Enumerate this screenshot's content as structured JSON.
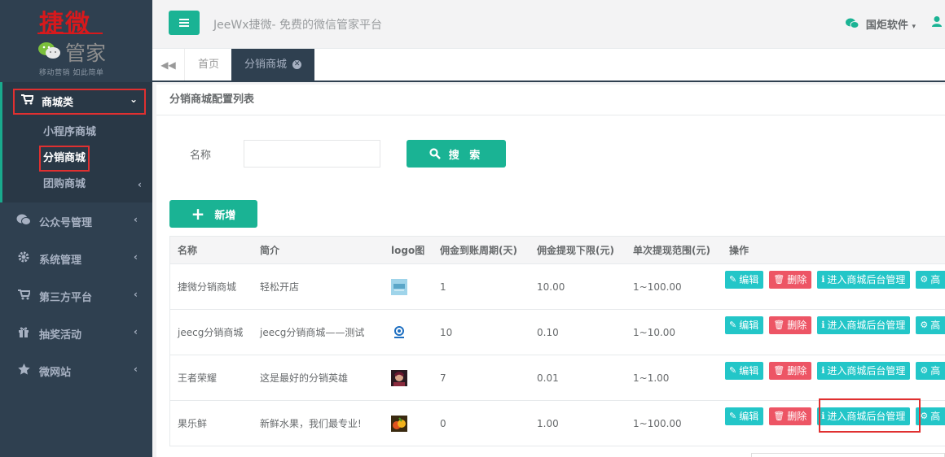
{
  "brand": {
    "logo_top": "捷微",
    "logo_bottom": "管家",
    "logo_sub": "移动营销 如此简单"
  },
  "sidebar": {
    "items": [
      {
        "label": "商城类",
        "icon": "cart-icon",
        "expanded": true
      },
      {
        "label": "公众号管理",
        "icon": "wechat-icon"
      },
      {
        "label": "系统管理",
        "icon": "gear-icon"
      },
      {
        "label": "第三方平台",
        "icon": "cart-icon"
      },
      {
        "label": "抽奖活动",
        "icon": "gift-icon"
      },
      {
        "label": "微网站",
        "icon": "star-icon"
      }
    ],
    "subitems": [
      {
        "label": "小程序商城"
      },
      {
        "label": "分销商城",
        "active": true
      },
      {
        "label": "团购商城"
      }
    ]
  },
  "topbar": {
    "title": "JeeWx捷微- 免费的微信管家平台",
    "user": "国炬软件"
  },
  "tabs": {
    "home": "首页",
    "active": "分销商城"
  },
  "panel": {
    "title": "分销商城配置列表",
    "search_label": "名称",
    "search_value": "",
    "search_button": "搜 索",
    "add_button": "新增"
  },
  "table": {
    "columns": [
      "名称",
      "简介",
      "logo图",
      "佣金到账周期(天)",
      "佣金提现下限(元)",
      "单次提现范围(元)",
      "操作"
    ],
    "rows": [
      {
        "name": "捷微分销商城",
        "desc": "轻松开店",
        "cycle": "1",
        "min": "10.00",
        "range": "1~100.00"
      },
      {
        "name": "jeecg分销商城",
        "desc": "jeecg分销商城——测试",
        "cycle": "10",
        "min": "0.10",
        "range": "1~10.00"
      },
      {
        "name": "王者荣耀",
        "desc": "这是最好的分销英雄",
        "cycle": "7",
        "min": "0.01",
        "range": "1~1.00"
      },
      {
        "name": "果乐鲜",
        "desc": "新鲜水果，我们最专业!",
        "cycle": "0",
        "min": "1.00",
        "range": "1~100.00"
      }
    ],
    "ops": {
      "edit": "编辑",
      "delete": "删除",
      "enter": "进入商城后台管理",
      "more": "高"
    }
  },
  "colors": {
    "primary": "#1ab394",
    "sidebar": "#2f4050",
    "danger": "#ed5565",
    "info": "#23c6c8"
  }
}
